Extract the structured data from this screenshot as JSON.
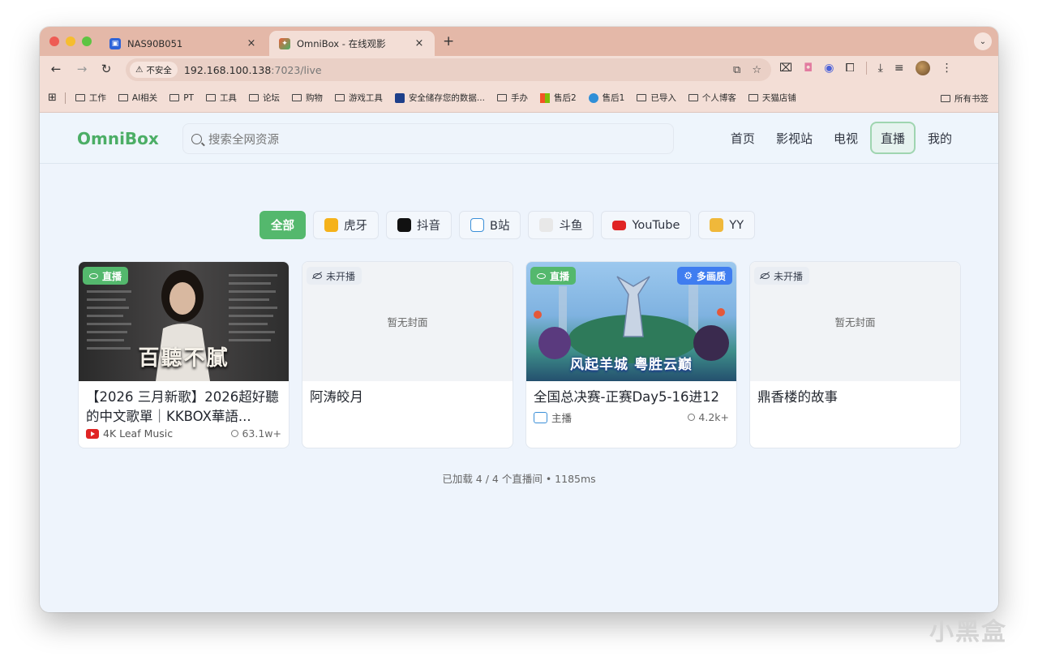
{
  "browser": {
    "tabs": [
      {
        "title": "NAS90B051",
        "favicon": "nas-icon",
        "active": false
      },
      {
        "title": "OmniBox - 在线观影",
        "favicon": "omnibox-icon",
        "active": true
      }
    ],
    "new_tab": "+",
    "close": "×",
    "address": {
      "security": "不安全",
      "host": "192.168.100.138",
      "port_path": ":7023/live"
    },
    "bookmarks": [
      {
        "label": "工作",
        "icon": "folder-icon"
      },
      {
        "label": "AI相关",
        "icon": "folder-icon"
      },
      {
        "label": "PT",
        "icon": "folder-icon"
      },
      {
        "label": "工具",
        "icon": "folder-icon"
      },
      {
        "label": "论坛",
        "icon": "folder-icon"
      },
      {
        "label": "购物",
        "icon": "folder-icon"
      },
      {
        "label": "游戏工具",
        "icon": "folder-icon"
      },
      {
        "label": "安全储存您的数据...",
        "icon": "storage-icon"
      },
      {
        "label": "手办",
        "icon": "folder-icon"
      },
      {
        "label": "售后2",
        "icon": "microsoft-icon"
      },
      {
        "label": "售后1",
        "icon": "globe-icon"
      },
      {
        "label": "已导入",
        "icon": "folder-icon"
      },
      {
        "label": "个人博客",
        "icon": "folder-icon"
      },
      {
        "label": "天猫店铺",
        "icon": "folder-icon"
      }
    ],
    "all_bookmarks": "所有书签"
  },
  "app": {
    "logo": "OmniBox",
    "search_placeholder": "搜索全网资源",
    "nav": [
      "首页",
      "影视站",
      "电视",
      "直播",
      "我的"
    ],
    "active_nav": "直播",
    "accent": "#54b86d"
  },
  "filters": [
    {
      "label": "全部",
      "active": true,
      "icon": ""
    },
    {
      "label": "虎牙",
      "active": false,
      "icon": "huya-icon"
    },
    {
      "label": "抖音",
      "active": false,
      "icon": "douyin-icon"
    },
    {
      "label": "B站",
      "active": false,
      "icon": "bilibili-icon"
    },
    {
      "label": "斗鱼",
      "active": false,
      "icon": "douyu-icon"
    },
    {
      "label": "YouTube",
      "active": false,
      "icon": "youtube-icon"
    },
    {
      "label": "YY",
      "active": false,
      "icon": "yy-icon"
    }
  ],
  "cards": [
    {
      "status": "直播",
      "live": true,
      "title": "【2026 三月新歌】2026超好聽的中文歌單｜KKBOX華語...",
      "source": "4K Leaf Music",
      "viewers": "63.1w+",
      "cover": "百聽不膩"
    },
    {
      "status": "未开播",
      "live": false,
      "title": "阿涛皎月",
      "no_cover": "暂无封面"
    },
    {
      "status": "直播",
      "live": true,
      "quality": "多画质",
      "title": "全国总决赛-正赛Day5-16进12",
      "source": "主播",
      "viewers": "4.2k+",
      "cover": "风起羊城 粤胜云巅"
    },
    {
      "status": "未开播",
      "live": false,
      "title": "鼎香楼的故事",
      "no_cover": "暂无封面"
    }
  ],
  "footer": "已加载 4 / 4 个直播间 • 1185ms",
  "watermark": "小黑盒"
}
